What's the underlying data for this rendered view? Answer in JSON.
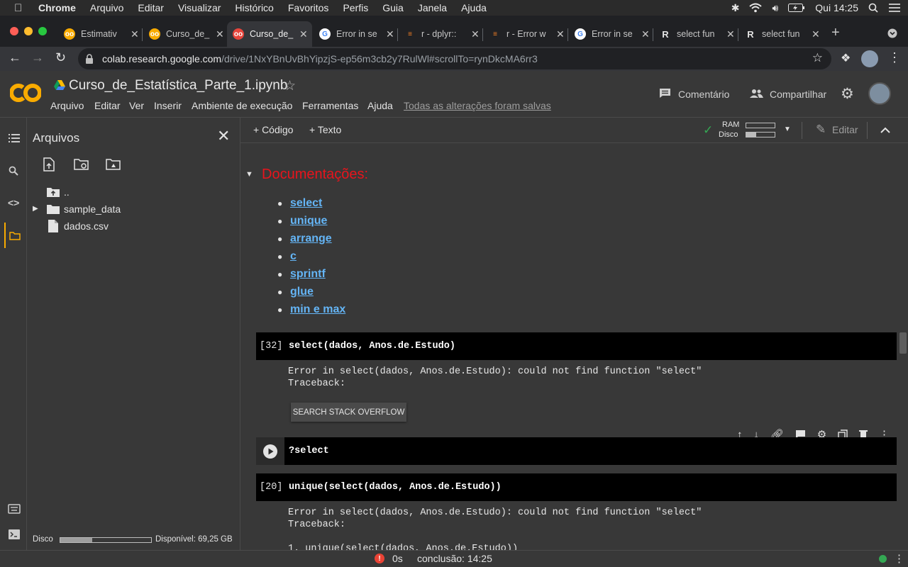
{
  "menubar": {
    "app": "Chrome",
    "items": [
      "Arquivo",
      "Editar",
      "Visualizar",
      "Histórico",
      "Favoritos",
      "Perfis",
      "Guia",
      "Janela",
      "Ajuda"
    ],
    "clock": "Qui 14:25"
  },
  "tabs": [
    {
      "title": "Estimativ",
      "favicon": "colab-icon"
    },
    {
      "title": "Curso_de_",
      "favicon": "colab-icon"
    },
    {
      "title": "Curso_de_",
      "favicon": "colab-icon"
    },
    {
      "title": "Error in se",
      "favicon": "google-icon"
    },
    {
      "title": "r - dplyr::",
      "favicon": "stackoverflow-icon"
    },
    {
      "title": "r - Error w",
      "favicon": "stackoverflow-icon"
    },
    {
      "title": "Error in se",
      "favicon": "google-icon"
    },
    {
      "title": "select fun",
      "favicon": "r-icon"
    },
    {
      "title": "select fun",
      "favicon": "r-icon"
    }
  ],
  "address": {
    "host": "colab.research.google.com",
    "path": "/drive/1NxYBnUvBhYipzjS-ep56m3cb2y7RulWl#scrollTo=rynDkcMA6rr3"
  },
  "colab": {
    "logo": "CO",
    "notebook_title": "Curso_de_Estatística_Parte_1.ipynb",
    "menu": [
      "Arquivo",
      "Editar",
      "Ver",
      "Inserir",
      "Ambiente de execução",
      "Ferramentas",
      "Ajuda"
    ],
    "save_status": "Todas as alterações foram salvas",
    "comment_label": "Comentário",
    "share_label": "Compartilhar"
  },
  "files_panel": {
    "title": "Arquivos",
    "items": [
      {
        "name": "..",
        "type": "parent-folder"
      },
      {
        "name": "sample_data",
        "type": "folder"
      },
      {
        "name": "dados.csv",
        "type": "file"
      }
    ],
    "disk_label": "Disco",
    "disk_available": "Disponível: 69,25 GB",
    "disk_used_fraction": 0.35
  },
  "notebook_toolbar": {
    "add_code": "+ Código",
    "add_text": "+ Texto",
    "ram_label": "RAM",
    "disk_label": "Disco",
    "edit_label": "Editar"
  },
  "doc_section": {
    "heading": "Documentações:",
    "links": [
      "select",
      "unique",
      "arrange",
      "c",
      "sprintf",
      "glue",
      "min e max"
    ]
  },
  "cells": [
    {
      "exec_count": "[32]",
      "code": "select(dados, Anos.de.Estudo)",
      "output": "Error in select(dados, Anos.de.Estudo): could not find function \"select\"\nTraceback:",
      "button": "SEARCH STACK OVERFLOW"
    },
    {
      "exec_count": "",
      "code": "?select"
    },
    {
      "exec_count": "[20]",
      "code": "unique(select(dados, Anos.de.Estudo))",
      "output": "Error in select(dados, Anos.de.Estudo): could not find function \"select\"\nTraceback:",
      "output_tail": "1. unique(select(dados, Anos.de.Estudo))"
    }
  ],
  "status": {
    "elapsed": "0s",
    "completion": "conclusão: 14:25"
  },
  "colors": {
    "accent_orange": "#f9ab00",
    "heading_red": "#e8141c",
    "link_blue": "#64b5f6",
    "ok_green": "#34a853"
  }
}
